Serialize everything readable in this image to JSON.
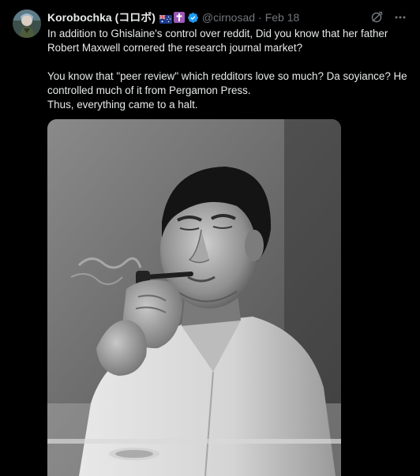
{
  "post": {
    "author": {
      "display_name": "Korobochka (コロボ)",
      "handle": "@cirnosad",
      "flag_emoji": "australia-flag-icon",
      "cross_emoji": "latin-cross-icon",
      "verified_icon": "verified-badge-icon"
    },
    "separator": "·",
    "timestamp": "Feb 18",
    "text_lines": [
      "In addition to Ghislaine's control over reddit, Did you know that her father Robert Maxwell cornered the research journal market?",
      "You know that \"peer review\" which redditors love so much? Da soyiance? He controlled much of it from Pergamon Press.",
      "Thus, everything came to a halt."
    ],
    "media": {
      "type": "photo",
      "style": "black-and-white",
      "subject": "man smoking a pipe"
    },
    "actions": {
      "grok_icon": "grok-icon",
      "more_icon": "more-dots-icon"
    }
  },
  "colors": {
    "background": "#000000",
    "primary_text": "#e7e9ea",
    "secondary_text": "#71767b",
    "verified_blue": "#1d9bf0",
    "cross_purple": "#9b59b6"
  }
}
